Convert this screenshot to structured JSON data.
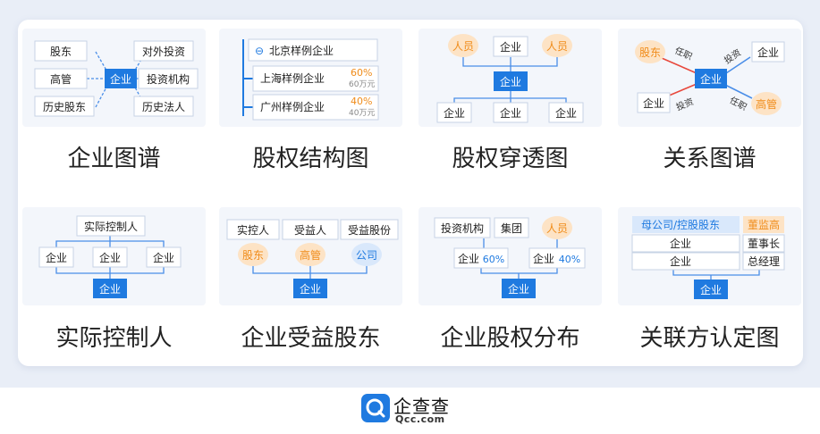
{
  "colors": {
    "accent": "#1f7ae0",
    "orange": "#f08c1a",
    "red": "#e8483c",
    "line_blue": "#4a8ee8",
    "card_bg": "#f3f6fb",
    "page_bg": "#e9eef7"
  },
  "cards": {
    "enterprise_graph": {
      "title": "企业图谱",
      "center": "企业",
      "left": [
        "股东",
        "高管",
        "历史股东"
      ],
      "right": [
        "对外投资",
        "投资机构",
        "历史法人"
      ]
    },
    "equity_structure": {
      "title": "股权结构图",
      "root": "北京样例企业",
      "collapse_symbol": "⊖",
      "children": [
        {
          "name": "上海样例企业",
          "percent": "60%",
          "amount": "60万元"
        },
        {
          "name": "广州样例企业",
          "percent": "40%",
          "amount": "40万元"
        }
      ]
    },
    "equity_penetration": {
      "title": "股权穿透图",
      "top": [
        "人员",
        "企业",
        "人员"
      ],
      "center": "企业",
      "bottom": [
        "企业",
        "企业",
        "企业"
      ]
    },
    "relationship_graph": {
      "title": "关系图谱",
      "center": "企业",
      "top_left": "股东",
      "top_right": "企业",
      "bottom_left": "企业",
      "bottom_right": "高管",
      "edges": [
        "任职",
        "投资",
        "投资",
        "任职"
      ]
    },
    "actual_controller": {
      "title": "实际控制人",
      "top": "实际控制人",
      "middle": [
        "企业",
        "企业",
        "企业"
      ],
      "bottom": "企业"
    },
    "beneficial_owner": {
      "title": "企业受益股东",
      "headers": [
        "实控人",
        "受益人",
        "受益股份"
      ],
      "values": [
        "股东",
        "高管",
        "公司"
      ],
      "bottom": "企业"
    },
    "equity_distribution": {
      "title": "企业股权分布",
      "top": [
        "投资机构",
        "集团",
        "人员"
      ],
      "middle": [
        {
          "name": "企业",
          "percent": "60%"
        },
        {
          "name": "企业",
          "percent": "40%"
        }
      ],
      "bottom": "企业"
    },
    "related_party": {
      "title": "关联方认定图",
      "left_header": "母公司/控股股东",
      "left_rows": [
        "企业",
        "企业"
      ],
      "right_header": "董监高",
      "right_rows": [
        "董事长",
        "总经理"
      ],
      "bottom": "企业"
    }
  },
  "footer": {
    "brand_name": "企查查",
    "brand_domain": "Qcc.com"
  }
}
